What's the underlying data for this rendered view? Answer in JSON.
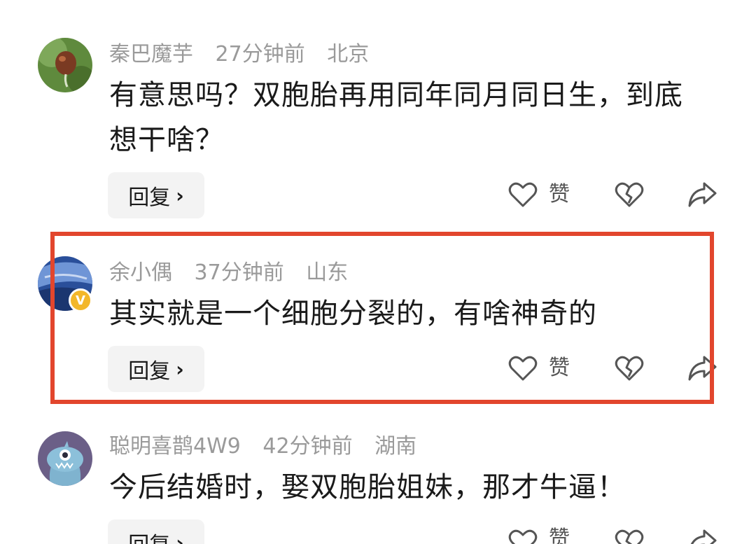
{
  "comments": [
    {
      "username": "秦巴魔芋",
      "time": "27分钟前",
      "location": "北京",
      "text": "有意思吗？双胞胎再用同年同月同日生，到底想干啥？",
      "reply_label": "回复",
      "like_label": "赞"
    },
    {
      "username": "余小偶",
      "time": "37分钟前",
      "location": "山东",
      "text": "其实就是一个细胞分裂的，有啥神奇的",
      "reply_label": "回复",
      "like_label": "赞",
      "badge": "V",
      "highlighted": true
    },
    {
      "username": "聪明喜鹊4W9",
      "time": "42分钟前",
      "location": "湖南",
      "text": "今后结婚时，娶双胞胎姐妹，那才牛逼！",
      "reply_label": "回复",
      "like_label": "赞"
    }
  ],
  "colors": {
    "highlight": "#e2462d",
    "meta_text": "#9a9a9a",
    "badge": "#f3b72a"
  },
  "icons": [
    "heart-icon",
    "broken-heart-icon",
    "share-icon",
    "chevron-right-icon"
  ]
}
